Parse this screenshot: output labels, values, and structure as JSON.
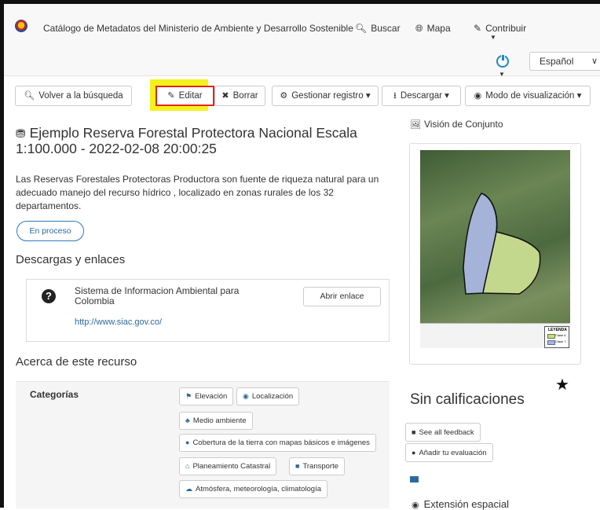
{
  "navbar": {
    "site_title": "Catálogo de Metadatos del Ministerio de Ambiente y Desarrollo Sostenible",
    "search_label": "Buscar",
    "map_label": "Mapa",
    "contribute_label": "Contribuir",
    "language": "Español"
  },
  "toolbar": {
    "back_label": "Volver a la búsqueda",
    "edit_label": "Editar",
    "delete_label": "Borrar",
    "manage_label": "Gestionar registro",
    "download_label": "Descargar",
    "view_mode_label": "Modo de visualización"
  },
  "record": {
    "title": "Ejemplo Reserva Forestal Protectora Nacional Escala 1:100.000 - 2022-02-08 20:00:25",
    "abstract": "Las Reservas Forestales Protectoras Productora son fuente de riqueza natural para un adecuado manejo del recurso hídrico , localizado en zonas rurales de los 32 departamentos.",
    "status": "En proceso"
  },
  "downloads": {
    "heading": "Descargas y enlaces",
    "link_name": "Sistema de Informacion Ambiental para Colombia",
    "link_url": "http://www.siac.gov.co/",
    "open_label": "Abrir enlace"
  },
  "about": {
    "heading": "Acerca de este recurso",
    "categories_label": "Categorías",
    "tags": [
      "Elevación",
      "Localización",
      "Medio ambiente",
      "Cobertura de la tierra con mapas básicos e imágenes",
      "Planeamiento Catastral",
      "Transporte",
      "Atmósfera, meteorología, climatología"
    ]
  },
  "sidebar": {
    "overview_heading": "Visión de Conjunto",
    "legend_title": "LEYENDA",
    "legend_items": [
      "Clase 6",
      "Clase 7"
    ],
    "rating_heading": "Sin calificaciones",
    "see_feedback_label": "See all feedback",
    "add_eval_label": "Añadir tu evaluación",
    "extent_label": "Extensión espacial"
  },
  "colors": {
    "accent": "#2b6aa0",
    "highlight": "#f4f21d",
    "edit_border": "#e2261c"
  }
}
